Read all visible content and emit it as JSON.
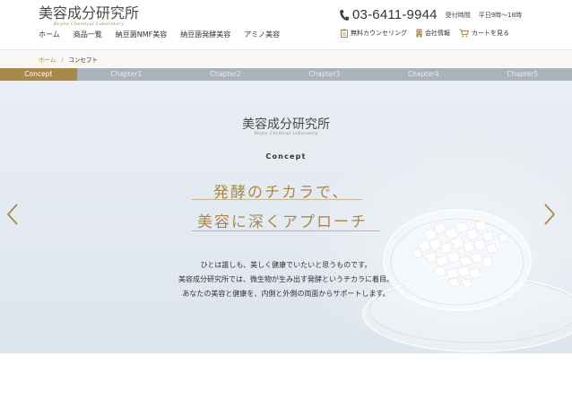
{
  "header": {
    "logo_text": "美容成分研究所",
    "logo_subtext": "Beyne Chemical Laboratory",
    "phone": "03-6411-9944",
    "hours_label": "受付時間",
    "hours_value": "平日9時～18時",
    "nav": [
      "ホーム",
      "商品一覧",
      "納豆菌NMF美容",
      "納豆菌発酵美容",
      "アミノ美容"
    ],
    "utility": {
      "counseling": "無料カウンセリング",
      "company": "会社情報",
      "cart": "カートを見る"
    }
  },
  "breadcrumb": {
    "home": "ホーム",
    "separator": "/",
    "current": "コンセプト"
  },
  "tabs": [
    "Concept",
    "Chapter1",
    "Chapter2",
    "Chapter3",
    "Chapter4",
    "Chapter5"
  ],
  "hero": {
    "logo_text": "美容成分研究所",
    "logo_subtext": "Beyne Chemical Laboratory",
    "section_label": "Concept",
    "headline_1": "発酵のチカラで、",
    "headline_2": "美容に深くアプローチ",
    "body": [
      "ひとは誰しも、美しく健康でいたいと思うものです。",
      "美容成分研究所では、微生物が生み出す発酵というチカラに着目。",
      "あなたの美容と健康を、内側と外側の両面からサポートします。"
    ]
  },
  "icons": {
    "phone": "phone-icon",
    "counseling": "clipboard-icon",
    "company": "building-icon",
    "cart": "cart-icon",
    "prev": "chevron-left-icon",
    "next": "chevron-right-icon"
  },
  "colors": {
    "accent_gold": "#a8894a",
    "tab_inactive": "#aab2bc",
    "hero_background": "#e6ecf2"
  }
}
